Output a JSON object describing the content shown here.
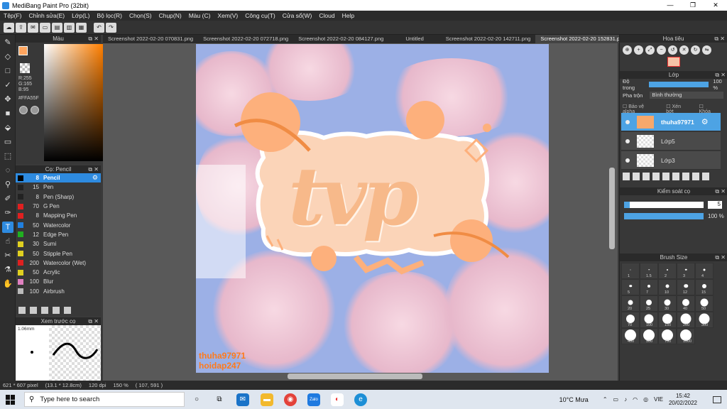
{
  "window": {
    "title": "MediBang Paint Pro (32bit)",
    "controls": [
      "—",
      "❐",
      "✕"
    ]
  },
  "menu": [
    "Tệp(F)",
    "Chỉnh sửa(E)",
    "Lớp(L)",
    "Bộ lọc(R)",
    "Chọn(S)",
    "Chụp(N)",
    "Màu (C)",
    "Xem(V)",
    "Công cụ(T)",
    "Cửa sổ(W)",
    "Cloud",
    "Help"
  ],
  "color_panel": {
    "title": "Màu",
    "rgb": [
      "R:255",
      "G:165",
      "B:95"
    ],
    "hex": "#FFA55F",
    "fg_color": "#ffa55f",
    "bg_color": "#5fa0ff"
  },
  "brush_panel": {
    "title": "Cọ: Pencil",
    "items": [
      {
        "size": "8",
        "name": "Pencil",
        "color": "#000000",
        "selected": true
      },
      {
        "size": "15",
        "name": "Pen",
        "color": "#222222"
      },
      {
        "size": "8",
        "name": "Pen (Sharp)",
        "color": "#222222"
      },
      {
        "size": "70",
        "name": "G Pen",
        "color": "#e02020"
      },
      {
        "size": "8",
        "name": "Mapping Pen",
        "color": "#e02020"
      },
      {
        "size": "50",
        "name": "Watercolor",
        "color": "#2080e0"
      },
      {
        "size": "12",
        "name": "Edge Pen",
        "color": "#20b020"
      },
      {
        "size": "30",
        "name": "Sumi",
        "color": "#e0d020"
      },
      {
        "size": "50",
        "name": "Stipple Pen",
        "color": "#e0d020"
      },
      {
        "size": "200",
        "name": "Watercolor (Wet)",
        "color": "#e02020"
      },
      {
        "size": "50",
        "name": "Acrylic",
        "color": "#e0d020"
      },
      {
        "size": "100",
        "name": "Blur",
        "color": "#e080c0"
      },
      {
        "size": "100",
        "name": "Airbrush",
        "color": "#bbbbbb"
      }
    ]
  },
  "preview_panel": {
    "title": "Xem trước cọ",
    "size": "1.06mm"
  },
  "tabs": [
    "Screenshot 2022-02-20 070831.png",
    "Screenshot 2022-02-20 072718.png",
    "Screenshot 2022-02-20 084127.png",
    "Untitled",
    "Screenshot 2022-02-20 142711.png",
    "Screenshot 2022-02-20 152831.png"
  ],
  "active_tab": 5,
  "artwork": {
    "text": "tvp",
    "signature_1": "thuha97971",
    "signature_2": "hoidap247"
  },
  "navigator": {
    "title": "Hoa tiêu"
  },
  "layers": {
    "title": "Lớp",
    "opacity_label": "Độ trong",
    "opacity_value": "100 %",
    "blend_label": "Pha trộn",
    "blend_value": "Bình thường",
    "check_protect_alpha": "Bảo vệ alpha",
    "check_clip": "Xén bớt",
    "check_lock": "Khóa",
    "items": [
      {
        "name": "thuha97971",
        "selected": true
      },
      {
        "name": "Lớp5"
      },
      {
        "name": "Lớp3"
      }
    ]
  },
  "brush_control": {
    "title": "Kiểm soát cọ",
    "size_value": "5",
    "size_fraction": 0.07,
    "opacity_value": "100 %",
    "opacity_fraction": 1.0
  },
  "brush_size": {
    "title": "Brush Size",
    "sizes": [
      "1",
      "1.5",
      "2",
      "3",
      "4",
      "5",
      "7",
      "10",
      "12",
      "15",
      "20",
      "25",
      "30",
      "40",
      "50",
      "70",
      "100",
      "150",
      "200",
      "300",
      "400",
      "500",
      "700",
      "1000"
    ]
  },
  "status": {
    "dims": "621 * 607 pixel",
    "cm": "(13.1 * 12.8cm)",
    "dpi": "120 dpi",
    "zoom": "150 %",
    "coords": "( 107, 591 )"
  },
  "taskbar": {
    "search_placeholder": "Type here to search",
    "weather": "10°C Mưa",
    "lang": "VIE",
    "time": "15:42",
    "date": "20/02/2022"
  },
  "colors": {
    "accent": "#2e8be0",
    "peach": "#ffa55f",
    "sky": "#9cb0e6"
  }
}
